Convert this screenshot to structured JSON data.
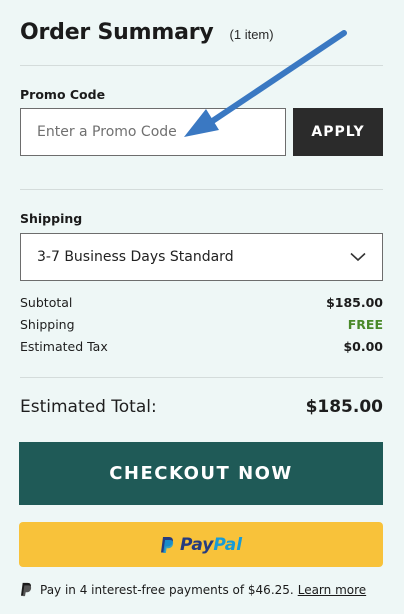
{
  "header": {
    "title": "Order Summary",
    "item_count": "(1 item)"
  },
  "promo": {
    "label": "Promo Code",
    "placeholder": "Enter a Promo Code",
    "apply_label": "APPLY"
  },
  "shipping": {
    "label": "Shipping",
    "selected": "3-7 Business Days Standard"
  },
  "summary": {
    "lines": [
      {
        "label": "Subtotal",
        "value": "$185.00"
      },
      {
        "label": "Shipping",
        "value": "FREE"
      },
      {
        "label": "Estimated Tax",
        "value": "$0.00"
      }
    ],
    "total_label": "Estimated Total:",
    "total_value": "$185.00"
  },
  "checkout": {
    "label": "CHECKOUT NOW"
  },
  "paypal": {
    "word_pay": "Pay",
    "word_pal": "Pal",
    "installments_text": "Pay in 4 interest-free payments of $46.25.",
    "learn_more": "Learn more"
  },
  "colors": {
    "background": "#eef7f6",
    "checkout": "#1f5a57",
    "paypal_button": "#f8c23a",
    "free_text": "#4a8a2a",
    "annotation_arrow": "#3a78c2"
  },
  "annotation": {
    "icon": "arrow-annotation-icon"
  }
}
